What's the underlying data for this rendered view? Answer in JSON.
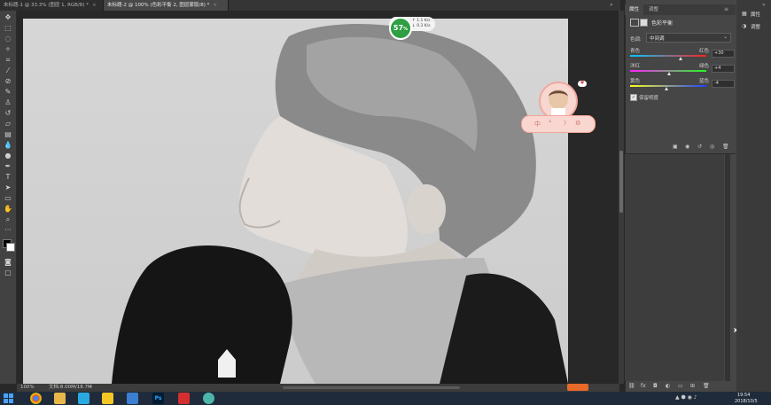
{
  "tabs": [
    {
      "label": "未标题-1 @ 33.3% (图层 1, RGB/8) *",
      "close": "×"
    },
    {
      "label": "未标题-2 @ 100% (色彩平衡 2, 图层蒙版/8) *",
      "close": "×"
    }
  ],
  "widget": {
    "percent": "57",
    "percent_suffix": "%",
    "upload": "↑ 1.1 K/s",
    "download": "↓ 0.3 K/s"
  },
  "panel": {
    "tabs": [
      "属性",
      "调整"
    ],
    "layer_title": "色彩平衡",
    "tone_label": "色调:",
    "tone_value": "中间调",
    "sliders": [
      {
        "left": "青色",
        "right": "红色",
        "value": "+30",
        "colors": [
          "#00c8ff",
          "#ff2020"
        ],
        "thumb": 0.67
      },
      {
        "left": "洋红",
        "right": "绿色",
        "value": "+4",
        "colors": [
          "#ff20ff",
          "#20ff20"
        ],
        "thumb": 0.52
      },
      {
        "left": "黄色",
        "right": "蓝色",
        "value": "-4",
        "colors": [
          "#ffff20",
          "#2040ff"
        ],
        "thumb": 0.48
      }
    ],
    "preserve_label": "保留明度"
  },
  "right_strip": [
    "属性",
    "调整"
  ],
  "status": {
    "zoom": "100%",
    "doc": "文档:8.00M/18.7M"
  },
  "taskbar": {
    "time": "19:54",
    "date": "2018/10/5"
  },
  "colors": {
    "accent": "#2e9f43",
    "panel": "#464646",
    "bg": "#282828",
    "taskbar": "#1f2b3a"
  }
}
